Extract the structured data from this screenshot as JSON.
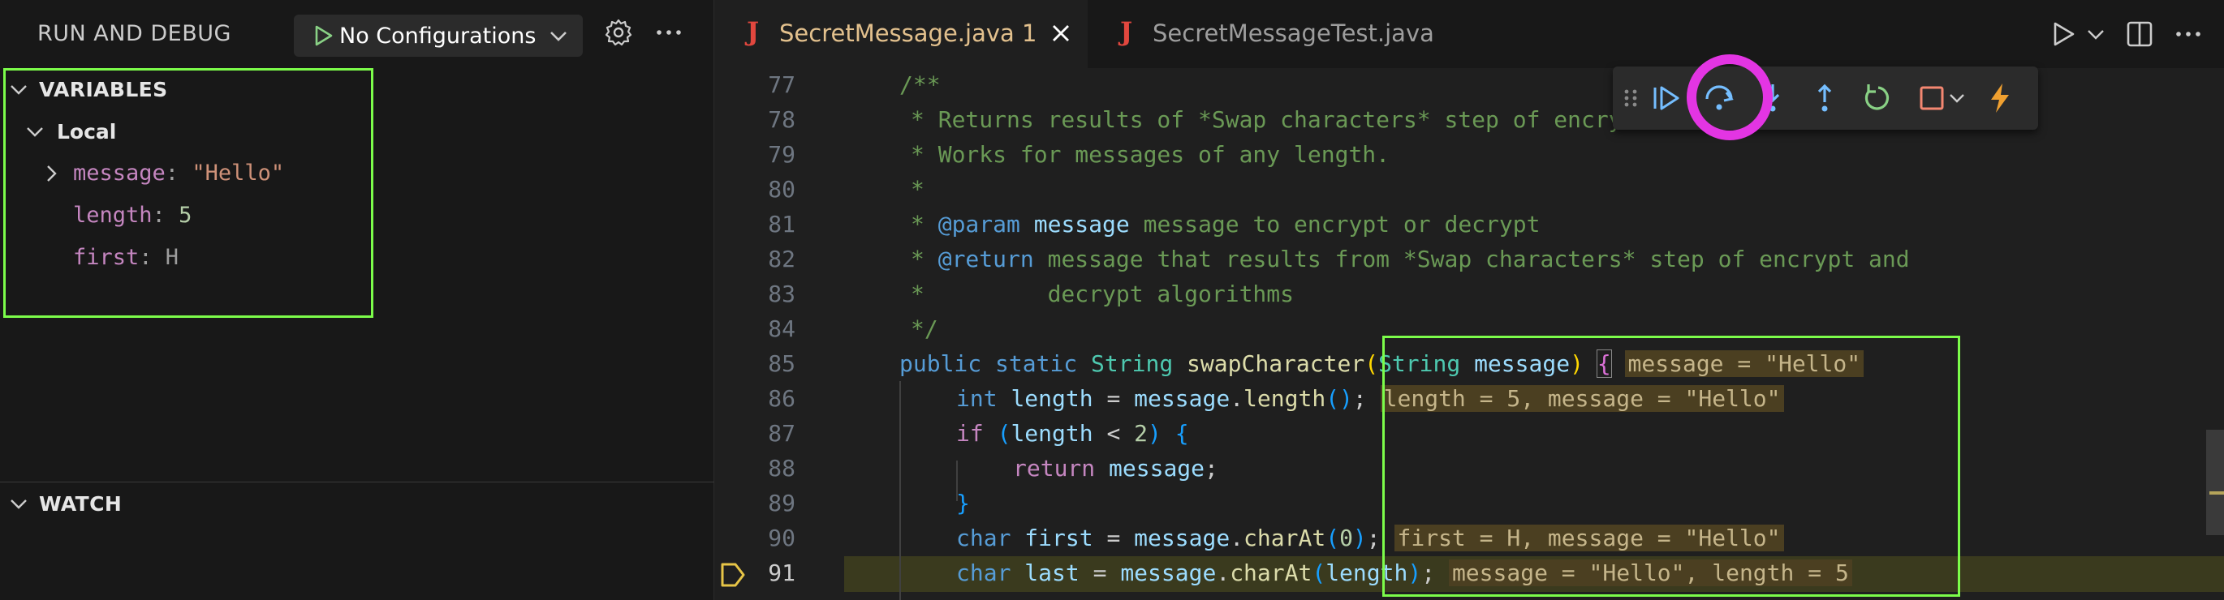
{
  "sidebar": {
    "title": "RUN AND DEBUG",
    "config_label": "No Configurations",
    "variables_header": "VARIABLES",
    "local_scope": "Local",
    "variables": [
      {
        "name": "message",
        "sep": ": ",
        "value": "\"Hello\"",
        "value_type": "string",
        "expandable": true
      },
      {
        "name": "length",
        "sep": ": ",
        "value": "5",
        "value_type": "number",
        "expandable": false
      },
      {
        "name": "first",
        "sep": ": ",
        "value": "H",
        "value_type": "char",
        "expandable": false
      }
    ],
    "watch_header": "WATCH"
  },
  "tabs": [
    {
      "icon": "J",
      "label": "SecretMessage.java",
      "badge": "1",
      "active": true
    },
    {
      "icon": "J",
      "label": "SecretMessageTest.java",
      "active": false
    }
  ],
  "debug_toolbar": {
    "buttons": [
      "drag-handle-icon",
      "continue-icon",
      "step-over-icon",
      "step-into-icon",
      "step-out-icon",
      "restart-icon",
      "stop-icon",
      "hot-code-replace-icon"
    ]
  },
  "editor": {
    "line_numbers": [
      "77",
      "78",
      "79",
      "80",
      "81",
      "82",
      "83",
      "84",
      "85",
      "86",
      "87",
      "88",
      "89",
      "90",
      "91"
    ],
    "current_line": "91",
    "lines": {
      "l77": "/**",
      "l78": "* Returns results of *Swap characters* step of encry",
      "l78b": "...",
      "l79": "* Works for messages of any length.",
      "l80": "*",
      "l81a": "* ",
      "l81tag": "@param",
      "l81var": "message",
      "l81rest": " message to encrypt or decrypt",
      "l82a": "* ",
      "l82tag": "@return",
      "l82rest": " message that results from *Swap characters* step of encrypt and",
      "l83": "*         decrypt algorithms",
      "l84": "*/",
      "l85_public": "public",
      "l85_static": "static",
      "l85_type": "String",
      "l85_fn": "swapCharacter",
      "l85_ptype": "String",
      "l85_param": "message",
      "l85_inline": "message = \"Hello\"",
      "l86_int": "int",
      "l86_var": "length",
      "l86_eq": " = ",
      "l86_obj": "message",
      "l86_fn": "length",
      "l86_inline": "length = 5, message = \"Hello\"",
      "l87_if": "if",
      "l87_var": "length",
      "l87_op": " < ",
      "l87_num": "2",
      "l88_ret": "return",
      "l88_var": "message",
      "l89": "}",
      "l90_char": "char",
      "l90_var": "first",
      "l90_obj": "message",
      "l90_fn": "charAt",
      "l90_num": "0",
      "l90_inline": "first = H, message = \"Hello\"",
      "l91_char": "char",
      "l91_var": "last",
      "l91_obj": "message",
      "l91_fn": "charAt",
      "l91_arg": "length",
      "l91_inline": "message = \"Hello\", length = 5"
    }
  },
  "colors": {
    "highlight_box": "#7cfc4a",
    "step_over_ring": "#e335e3",
    "breakpoint_arrow": "#e7c547"
  }
}
